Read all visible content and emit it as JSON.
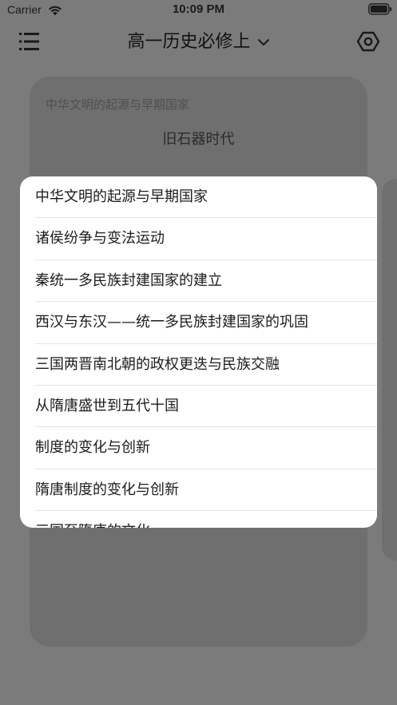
{
  "status_bar": {
    "carrier": "Carrier",
    "time": "10:09 PM"
  },
  "nav": {
    "title": "高一历史必修上",
    "menu_icon": "list-icon",
    "settings_icon": "hexagon-gear-icon",
    "title_icon": "chevron-down-icon"
  },
  "card": {
    "subtitle": "中华文明的起源与早期国家",
    "title": "旧石器时代"
  },
  "dropdown": {
    "items": [
      {
        "label": "中华文明的起源与早期国家"
      },
      {
        "label": "诸侯纷争与变法运动"
      },
      {
        "label": "秦统一多民族封建国家的建立"
      },
      {
        "label": "西汉与东汉——统一多民族封建国家的巩固"
      },
      {
        "label": "三国两晋南北朝的政权更迭与民族交融"
      },
      {
        "label": "从隋唐盛世到五代十国"
      },
      {
        "label": "制度的变化与创新"
      },
      {
        "label": "隋唐制度的变化与创新"
      },
      {
        "label": "三国至隋唐的文化"
      }
    ]
  },
  "colors": {
    "overlay_background": "#7b7b7b",
    "card_background": "#6f6f6f",
    "dropdown_background": "#ffffff"
  }
}
